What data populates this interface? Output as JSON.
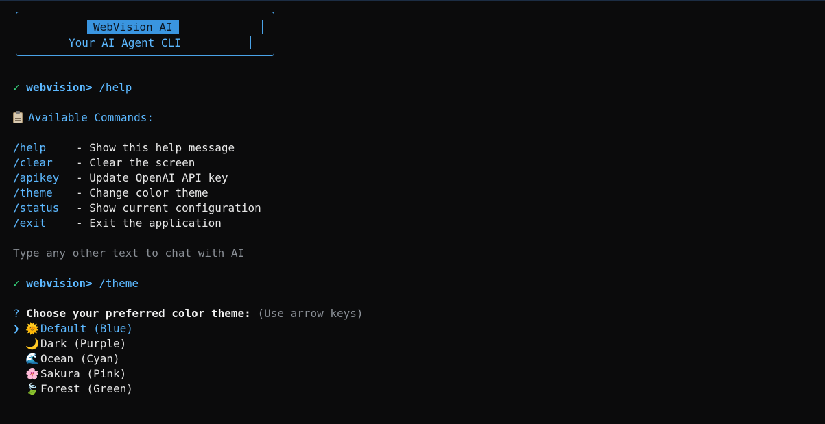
{
  "banner": {
    "title": "WebVision AI",
    "subtitle": "Your AI Agent CLI"
  },
  "session": {
    "prompt_check": "✓",
    "prompt_label": "webvision>",
    "first_command": "/help",
    "second_command": "/theme"
  },
  "help": {
    "heading": "Available Commands:",
    "commands": [
      {
        "name": "/help",
        "desc": "- Show this help message"
      },
      {
        "name": "/clear",
        "desc": "- Clear the screen"
      },
      {
        "name": "/apikey",
        "desc": "- Update OpenAI API key"
      },
      {
        "name": "/theme",
        "desc": "- Change color theme"
      },
      {
        "name": "/status",
        "desc": "- Show current configuration"
      },
      {
        "name": "/exit",
        "desc": "- Exit the application"
      }
    ],
    "hint": "Type any other text to chat with AI"
  },
  "theme_prompt": {
    "question_mark": "?",
    "question": "Choose your preferred color theme:",
    "hint": "(Use arrow keys)",
    "pointer": "❯",
    "options": [
      {
        "icon": "🌞",
        "icon_name": "sun-icon",
        "label": "Default (Blue)",
        "selected": true
      },
      {
        "icon": "🌙",
        "icon_name": "moon-icon",
        "label": "Dark (Purple)",
        "selected": false
      },
      {
        "icon": "🌊",
        "icon_name": "wave-icon",
        "label": "Ocean (Cyan)",
        "selected": false
      },
      {
        "icon": "🌸",
        "icon_name": "cherry-blossom-icon",
        "label": "Sakura (Pink)",
        "selected": false
      },
      {
        "icon": "🍃",
        "icon_name": "leaf-icon",
        "label": "Forest (Green)",
        "selected": false
      }
    ]
  },
  "colors": {
    "background": "#0b0b0c",
    "accent_blue": "#5cb8ff",
    "check_green": "#36d07a",
    "dim_text": "#8a8f96"
  }
}
